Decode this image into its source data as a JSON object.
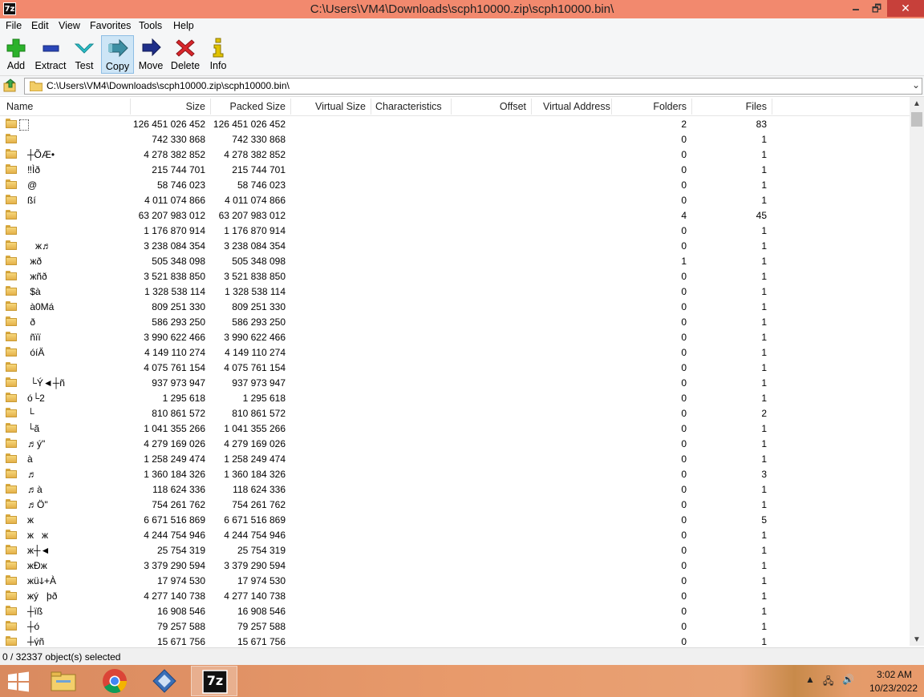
{
  "window": {
    "app_icon": "7z",
    "title": "C:\\Users\\VM4\\Downloads\\scph10000.zip\\scph10000.bin\\",
    "minimize": "🗕",
    "maximize": "🗗",
    "close": "✕"
  },
  "menu": [
    "File",
    "Edit",
    "View",
    "Favorites",
    "Tools",
    "Help"
  ],
  "toolbar": [
    {
      "label": "Add",
      "icon": "plus-icon",
      "color": "#2bb22b"
    },
    {
      "label": "Extract",
      "icon": "minus-icon",
      "color": "#2a46b8"
    },
    {
      "label": "Test",
      "icon": "checkmark-icon",
      "color": "#2bbfc9"
    },
    {
      "label": "Copy",
      "icon": "copy-arrow-icon",
      "color": "#3c8ea3"
    },
    {
      "label": "Move",
      "icon": "move-arrow-icon",
      "color": "#1f2f8a"
    },
    {
      "label": "Delete",
      "icon": "delete-x-icon",
      "color": "#d8262b"
    },
    {
      "label": "Info",
      "icon": "info-icon",
      "color": "#e0c200"
    }
  ],
  "address": {
    "path": "C:\\Users\\VM4\\Downloads\\scph10000.zip\\scph10000.bin\\",
    "dropdown": "⌄"
  },
  "columns": [
    "Name",
    "Size",
    "Packed Size",
    "Virtual Size",
    "Characteristics",
    "Offset",
    "Virtual Address",
    "Folders",
    "Files"
  ],
  "rows": [
    {
      "name": "",
      "size": "126 451 026 452",
      "packed": "126 451 026 452",
      "folders": "2",
      "files": "83",
      "selected_box": true
    },
    {
      "name": "",
      "size": "742 330 868",
      "packed": "742 330 868",
      "folders": "0",
      "files": "1"
    },
    {
      "name": "┼ÕÆ•",
      "size": "4 278 382 852",
      "packed": "4 278 382 852",
      "folders": "0",
      "files": "1"
    },
    {
      "name": "‼Ìð",
      "size": "215 744 701",
      "packed": "215 744 701",
      "folders": "0",
      "files": "1"
    },
    {
      "name": "@",
      "size": "58 746 023",
      "packed": "58 746 023",
      "folders": "0",
      "files": "1"
    },
    {
      "name": "ßí",
      "size": "4 011 074 866",
      "packed": "4 011 074 866",
      "folders": "0",
      "files": "1"
    },
    {
      "name": "",
      "size": "63 207 983 012",
      "packed": "63 207 983 012",
      "folders": "4",
      "files": "45"
    },
    {
      "name": "",
      "size": "1 176 870 914",
      "packed": "1 176 870 914",
      "folders": "0",
      "files": "1"
    },
    {
      "name": "   ж♬",
      "size": "3 238 084 354",
      "packed": "3 238 084 354",
      "folders": "0",
      "files": "1"
    },
    {
      "name": " жð",
      "size": "505 348 098",
      "packed": "505 348 098",
      "folders": "1",
      "files": "1"
    },
    {
      "name": " жñð",
      "size": "3 521 838 850",
      "packed": "3 521 838 850",
      "folders": "0",
      "files": "1"
    },
    {
      "name": " $à",
      "size": "1 328 538 114",
      "packed": "1 328 538 114",
      "folders": "0",
      "files": "1"
    },
    {
      "name": " à0Má",
      "size": "809 251 330",
      "packed": "809 251 330",
      "folders": "0",
      "files": "1"
    },
    {
      "name": " ð",
      "size": "586 293 250",
      "packed": "586 293 250",
      "folders": "0",
      "files": "1"
    },
    {
      "name": " ñïï",
      "size": "3 990 622 466",
      "packed": "3 990 622 466",
      "folders": "0",
      "files": "1"
    },
    {
      "name": " óíÄ",
      "size": "4 149 110 274",
      "packed": "4 149 110 274",
      "folders": "0",
      "files": "1"
    },
    {
      "name": "",
      "size": "4 075 761 154",
      "packed": "4 075 761 154",
      "folders": "0",
      "files": "1"
    },
    {
      "name": " └Ý◄┼ñ",
      "size": "937 973 947",
      "packed": "937 973 947",
      "folders": "0",
      "files": "1"
    },
    {
      "name": "ó└2",
      "size": "1 295 618",
      "packed": "1 295 618",
      "folders": "0",
      "files": "1"
    },
    {
      "name": "└",
      "size": "810 861 572",
      "packed": "810 861 572",
      "folders": "0",
      "files": "2"
    },
    {
      "name": "└ã",
      "size": "1 041 355 266",
      "packed": "1 041 355 266",
      "folders": "0",
      "files": "1"
    },
    {
      "name": "♬ý\"",
      "size": "4 279 169 026",
      "packed": "4 279 169 026",
      "folders": "0",
      "files": "1"
    },
    {
      "name": "à",
      "size": "1 258 249 474",
      "packed": "1 258 249 474",
      "folders": "0",
      "files": "1"
    },
    {
      "name": "♬",
      "size": "1 360 184 326",
      "packed": "1 360 184 326",
      "folders": "0",
      "files": "3"
    },
    {
      "name": "♬à",
      "size": "118 624 336",
      "packed": "118 624 336",
      "folders": "0",
      "files": "1"
    },
    {
      "name": "♬Ö\"",
      "size": "754 261 762",
      "packed": "754 261 762",
      "folders": "0",
      "files": "1"
    },
    {
      "name": "ж",
      "size": "6 671 516 869",
      "packed": "6 671 516 869",
      "folders": "0",
      "files": "5"
    },
    {
      "name": "ж   ж",
      "size": "4 244 754 946",
      "packed": "4 244 754 946",
      "folders": "0",
      "files": "1"
    },
    {
      "name": "ж┼◄",
      "size": "25 754 319",
      "packed": "25 754 319",
      "folders": "0",
      "files": "1"
    },
    {
      "name": "жÐж",
      "size": "3 379 290 594",
      "packed": "3 379 290 594",
      "folders": "0",
      "files": "1"
    },
    {
      "name": "жüↆ+À",
      "size": "17 974 530",
      "packed": "17 974 530",
      "folders": "0",
      "files": "1"
    },
    {
      "name": "жý   þð",
      "size": "4 277 140 738",
      "packed": "4 277 140 738",
      "folders": "0",
      "files": "1"
    },
    {
      "name": "┼ïß",
      "size": "16 908 546",
      "packed": "16 908 546",
      "folders": "0",
      "files": "1"
    },
    {
      "name": "┼ó",
      "size": "79 257 588",
      "packed": "79 257 588",
      "folders": "0",
      "files": "1"
    },
    {
      "name": "┼ýñ",
      "size": "15 671 756",
      "packed": "15 671 756",
      "folders": "0",
      "files": "1"
    }
  ],
  "scroll": {
    "up": "▲",
    "down": "▼"
  },
  "status": "0 / 32337 object(s) selected",
  "taskbar": {
    "apps": [
      "file-explorer-icon",
      "chrome-icon",
      "remote-app-icon",
      "7zip-icon"
    ],
    "seven_zip_label": "7z",
    "tray": {
      "expand": "▲",
      "network": "🖧",
      "volume": "🔊"
    },
    "time": "3:02 AM",
    "date": "10/23/2022"
  }
}
